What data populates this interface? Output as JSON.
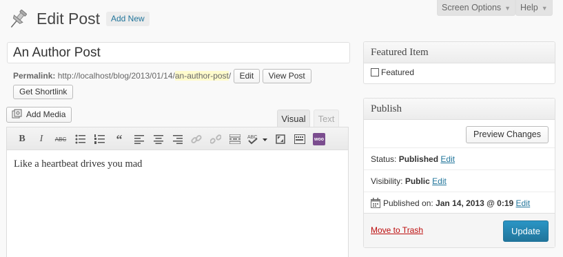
{
  "header": {
    "title": "Edit Post",
    "add_new_label": "Add New",
    "screen_options_label": "Screen Options",
    "help_label": "Help",
    "icon": "pushpin-icon"
  },
  "post": {
    "title_value": "An Author Post",
    "permalink_label": "Permalink:",
    "permalink_base": "http://localhost/blog/2013/01/14/",
    "permalink_slug": "an-author-post",
    "permalink_suffix": "/",
    "edit_label": "Edit",
    "view_post_label": "View Post",
    "get_shortlink_label": "Get Shortlink"
  },
  "editor": {
    "add_media_label": "Add Media",
    "tab_visual": "Visual",
    "tab_text": "Text",
    "content": "Like a heartbeat drives you mad",
    "toolbar_icons": [
      "bold-icon",
      "italic-icon",
      "strikethrough-icon",
      "bullet-list-icon",
      "numbered-list-icon",
      "blockquote-icon",
      "align-left-icon",
      "align-center-icon",
      "align-right-icon",
      "link-icon",
      "unlink-icon",
      "read-more-icon",
      "spellcheck-icon",
      "fullscreen-icon",
      "kitchen-sink-icon",
      "woo-shortcode-icon"
    ]
  },
  "featured": {
    "title": "Featured Item",
    "checkbox_label": "Featured",
    "checked": false
  },
  "publish": {
    "title": "Publish",
    "preview_label": "Preview Changes",
    "status_label": "Status:",
    "status_value": "Published",
    "visibility_label": "Visibility:",
    "visibility_value": "Public",
    "published_on_label": "Published on:",
    "published_on_value": "Jan 14, 2013 @ 0:19",
    "edit_link": "Edit",
    "trash_label": "Move to Trash",
    "update_label": "Update"
  },
  "colors": {
    "link": "#21759b",
    "trash": "#bc0b0b",
    "update_button": "#21759b",
    "slug_highlight": "#fffbcc"
  }
}
